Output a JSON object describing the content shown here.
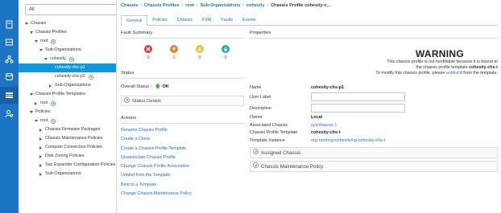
{
  "rail": {
    "icons": [
      "equipment-icon",
      "servers-icon",
      "network-icon",
      "san-icon",
      "storage-icon",
      "chassis-icon",
      "admin-icon"
    ],
    "active_index": 5
  },
  "nav": {
    "filter": {
      "selected": "All"
    },
    "tree": [
      {
        "label": "Chassis",
        "level": 0,
        "toggle": "down",
        "plus": false,
        "selected": false
      },
      {
        "label": "Chassis Profiles",
        "level": 1,
        "toggle": "down",
        "plus": false,
        "selected": false
      },
      {
        "label": "root",
        "level": 2,
        "toggle": "down",
        "plus": true,
        "selected": false
      },
      {
        "label": "Sub-Organizations",
        "level": 3,
        "toggle": "down",
        "plus": false,
        "selected": false
      },
      {
        "label": "cohesity",
        "level": 4,
        "toggle": "down",
        "plus": true,
        "selected": false
      },
      {
        "label": "cohesity-chs-p1",
        "level": 5,
        "toggle": "none",
        "plus": false,
        "selected": true
      },
      {
        "label": "cohesity-chs-p2",
        "level": 5,
        "toggle": "none",
        "plus": true,
        "selected": false
      },
      {
        "label": "Sub-Organizations",
        "level": 5,
        "toggle": "right",
        "plus": false,
        "selected": false
      },
      {
        "label": "Chassis Profile Templates",
        "level": 1,
        "toggle": "down",
        "plus": false,
        "selected": false
      },
      {
        "label": "root",
        "level": 2,
        "toggle": "right",
        "plus": true,
        "selected": false
      },
      {
        "label": "Policies",
        "level": 1,
        "toggle": "down",
        "plus": false,
        "selected": false
      },
      {
        "label": "root",
        "level": 2,
        "toggle": "down",
        "plus": true,
        "selected": false
      },
      {
        "label": "Chassis Firmware Packages",
        "level": 3,
        "toggle": "right",
        "plus": false,
        "selected": false
      },
      {
        "label": "Chassis Maintenance Policies",
        "level": 3,
        "toggle": "right",
        "plus": false,
        "selected": false
      },
      {
        "label": "Compute Connection Policies",
        "level": 3,
        "toggle": "right",
        "plus": false,
        "selected": false
      },
      {
        "label": "Disk Zoning Policies",
        "level": 3,
        "toggle": "right",
        "plus": false,
        "selected": false
      },
      {
        "label": "Sas Expander Configuration Policies",
        "level": 3,
        "toggle": "right",
        "plus": false,
        "selected": false
      },
      {
        "label": "Sub-Organizations",
        "level": 3,
        "toggle": "right",
        "plus": false,
        "selected": false
      }
    ]
  },
  "breadcrumb": {
    "items": [
      "Chassis",
      "Chassis Profiles",
      "root",
      "Sub-Organizations",
      "cohesity"
    ],
    "current": "Chassis Profile cohesity-c...",
    "separator": "/"
  },
  "tabs": [
    {
      "label": "General",
      "active": true
    },
    {
      "label": "Policies",
      "active": false
    },
    {
      "label": "Chassis",
      "active": false
    },
    {
      "label": "FSM",
      "active": false
    },
    {
      "label": "Faults",
      "active": false
    },
    {
      "label": "Events",
      "active": false
    }
  ],
  "fault_summary": {
    "title": "Fault Summary",
    "items": [
      {
        "icon": "critical-fault-icon",
        "color": "#d9403b",
        "count": "0"
      },
      {
        "icon": "major-fault-icon",
        "color": "#e8843b",
        "count": "0"
      },
      {
        "icon": "minor-fault-icon",
        "color": "#ebc13a",
        "count": "0"
      },
      {
        "icon": "warning-fault-icon",
        "color": "#2fa99f",
        "count": "0"
      }
    ]
  },
  "status": {
    "title": "Status",
    "overall_label": "Overall Status :",
    "overall_value": "OK",
    "details_label": "Status Details"
  },
  "actions": {
    "title": "Actions",
    "items": [
      "Rename Chassis Profile",
      "Create a Clone",
      "Create a Chassis Profile Template",
      "Disassociate Chassis Profile",
      "Change Chassis Profile Association",
      "Unbind from the Template",
      "Bind to a Template",
      "Change Chassis Maintenance Policy"
    ]
  },
  "properties": {
    "title": "Properties",
    "warning": {
      "heading": "WARNING",
      "line1": "This chassis profile is not modifiable because it is bound to",
      "line2_prefix": "the chassis profile template",
      "line2_template": "cohesity-chs-t",
      "line3_prefix": "To modify this chassis profile, please",
      "line3_link": "unbind",
      "line3_suffix": "it from the template."
    },
    "name_label": "Name",
    "name_value": "cohesity-chs-p1",
    "user_label_label": "User Label",
    "user_label_value": "",
    "description_label": "Description",
    "description_value": "",
    "owner_label": "Owner",
    "owner_value": "Local",
    "assoc_chassis_label": "Associated Chassis",
    "assoc_chassis_value": "sys/chassis-1",
    "template_label": "Chassis Profile Template",
    "template_value": "cohesity-chs-t",
    "template_instance_label": "Template Instance",
    "template_instance_value": "org-root/org-cohesity/cp-cohesity-chs-t",
    "colon": ":",
    "assigned_chassis_label": "Assigned Chassis",
    "maintenance_policy_label": "Chassis Maintenance Policy"
  }
}
